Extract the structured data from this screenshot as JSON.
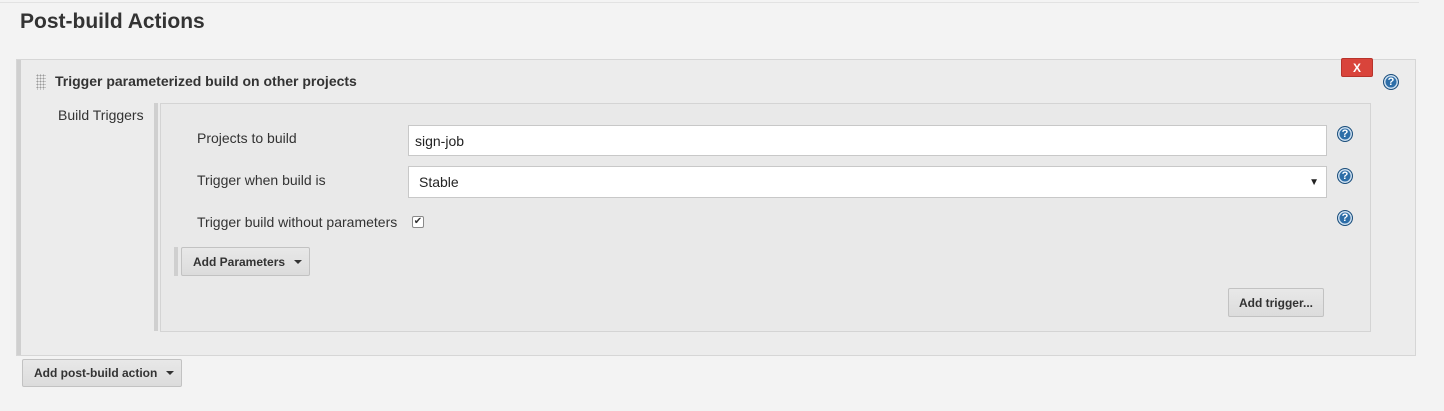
{
  "section": {
    "title": "Post-build Actions"
  },
  "block": {
    "title": "Trigger parameterized build on other projects",
    "delete_label": "X",
    "help_glyph": "?"
  },
  "build_triggers": {
    "label": "Build Triggers",
    "projects": {
      "label": "Projects to build",
      "value": "sign-job"
    },
    "condition": {
      "label": "Trigger when build is",
      "selected": "Stable"
    },
    "no_params": {
      "label": "Trigger build without parameters",
      "checked": true,
      "check_glyph": "✔"
    },
    "add_parameters_label": "Add Parameters",
    "add_trigger_label": "Add trigger..."
  },
  "footer": {
    "add_action_label": "Add post-build action"
  },
  "colors": {
    "delete": "#d9443b",
    "help": "#2d6ea8",
    "panel": "#ececec"
  },
  "icons": [
    "drag-handle-icon",
    "help-icon",
    "chevron-down-icon",
    "checkmark-icon"
  ]
}
